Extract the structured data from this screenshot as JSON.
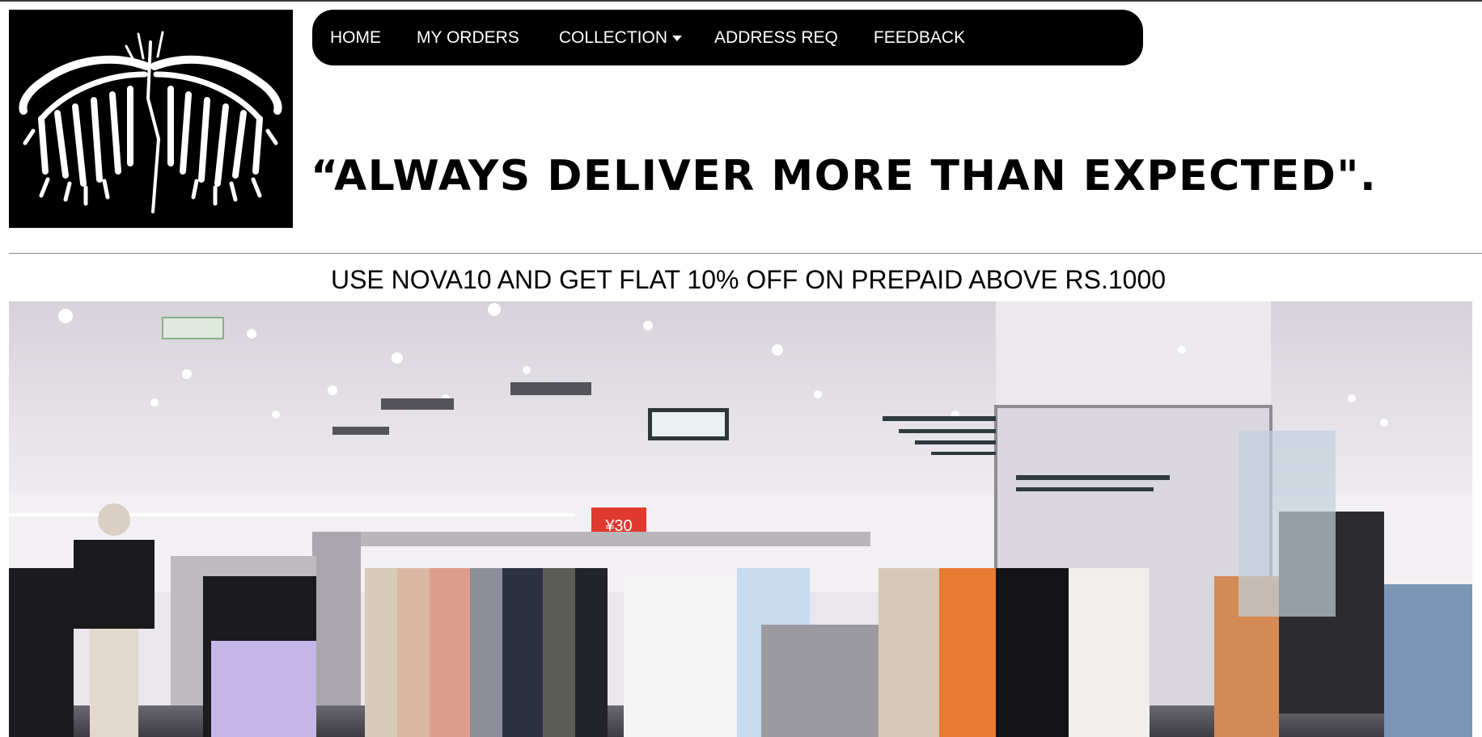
{
  "brand": {
    "logo_icon": "angel-wings-logo-icon"
  },
  "nav": {
    "items": [
      {
        "label": "HOME"
      },
      {
        "label": "MY ORDERS"
      },
      {
        "label": "COLLECTION",
        "has_dropdown": true
      },
      {
        "label": "ADDRESS REQ"
      },
      {
        "label": "FEEDBACK"
      }
    ],
    "dropdown_icon": "caret-down-icon"
  },
  "hero": {
    "tagline": "“ALWAYS DELIVER MORE THAN EXPECTED\".",
    "promo": "USE NOVA10 AND GET FLAT 10% OFF ON PREPAID ABOVE RS.1000",
    "banner_image": "clothing-store-interior-image",
    "price_sign": "¥30"
  },
  "colors": {
    "navbar_bg": "#000000",
    "nav_text": "#ffffff",
    "page_bg": "#ffffff",
    "price_sign": "#e03a2e"
  }
}
